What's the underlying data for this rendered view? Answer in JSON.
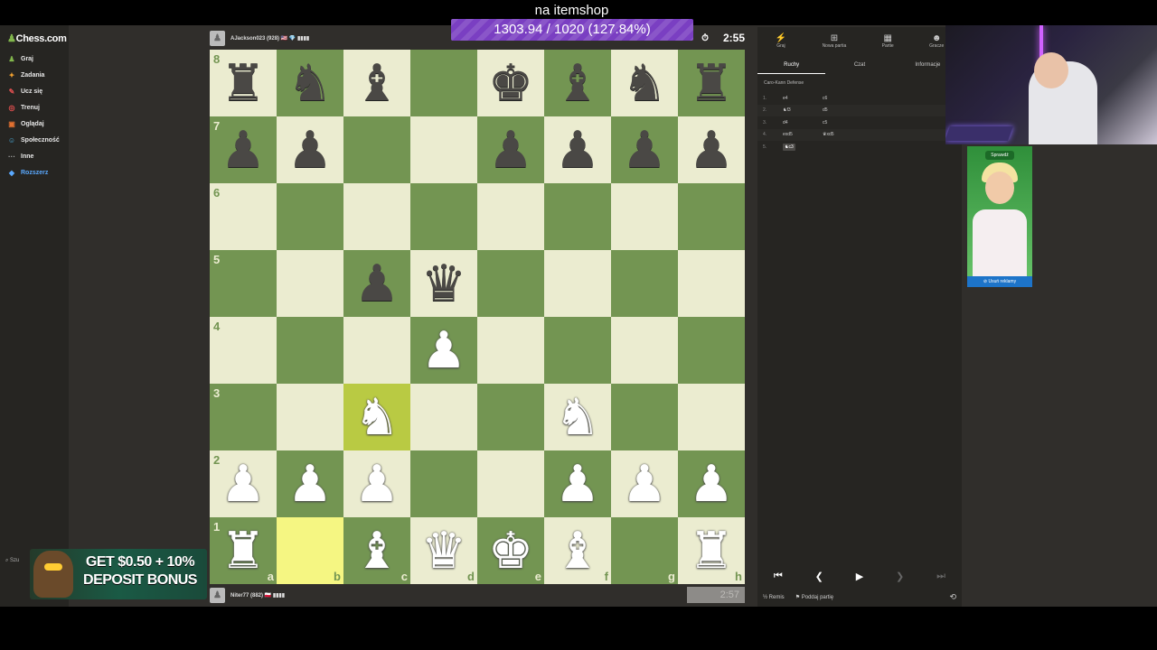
{
  "stream": {
    "title": "na itemshop",
    "counter": "1303.94 / 1020 (127.84%)"
  },
  "sidebar": {
    "logo": "Chess.com",
    "items": [
      {
        "label": "Graj",
        "icon": "play-icon",
        "glyph": "♟",
        "color": "#81b64c"
      },
      {
        "label": "Zadania",
        "icon": "puzzle-icon",
        "glyph": "✦",
        "color": "#f0a030"
      },
      {
        "label": "Ucz się",
        "icon": "learn-icon",
        "glyph": "✎",
        "color": "#e05050"
      },
      {
        "label": "Trenuj",
        "icon": "train-icon",
        "glyph": "◎",
        "color": "#e85050"
      },
      {
        "label": "Oglądaj",
        "icon": "watch-icon",
        "glyph": "▣",
        "color": "#e07030"
      },
      {
        "label": "Społeczność",
        "icon": "community-icon",
        "glyph": "☺",
        "color": "#4ab0e0"
      },
      {
        "label": "Inne",
        "icon": "more-icon",
        "glyph": "···",
        "color": "#aaa"
      },
      {
        "label": "Rozszerz",
        "icon": "diamond-icon",
        "glyph": "◆",
        "color": "#5aa9ff"
      }
    ],
    "bottom": "Szu"
  },
  "top_player": {
    "name": "AJackson023 (928) 🇺🇸 💎 ▮▮▮▮",
    "clock": "2:55",
    "clock_icon": "stopwatch-icon"
  },
  "bottom_player": {
    "name": "Niter77 (882) 🇵🇱 ▮▮▮▮",
    "clock": "2:57"
  },
  "board": {
    "ranks": [
      "8",
      "7",
      "6",
      "5",
      "4",
      "3",
      "2",
      "1"
    ],
    "files": [
      "a",
      "b",
      "c",
      "d",
      "e",
      "f",
      "g",
      "h"
    ],
    "rows": [
      [
        "r",
        "n",
        "b",
        "",
        "k",
        "b",
        "n",
        "r"
      ],
      [
        "p",
        "p",
        "",
        "",
        "p",
        "p",
        "p",
        "p"
      ],
      [
        "",
        "",
        "",
        "",
        "",
        "",
        "",
        ""
      ],
      [
        "",
        "",
        "p",
        "q",
        "",
        "",
        "",
        ""
      ],
      [
        "",
        "",
        "",
        "P",
        "",
        "",
        "",
        ""
      ],
      [
        "",
        "",
        "N",
        "",
        "",
        "N",
        "",
        ""
      ],
      [
        "P",
        "P",
        "P",
        "",
        "",
        "P",
        "P",
        "P"
      ],
      [
        "R",
        "",
        "B",
        "Q",
        "K",
        "B",
        "",
        "R"
      ]
    ],
    "highlights": [
      "b1",
      "c3"
    ]
  },
  "panel": {
    "top_tabs": [
      {
        "label": "Graj",
        "icon": "bolt-icon",
        "glyph": "⚡"
      },
      {
        "label": "Nowa partia",
        "icon": "new-game-icon",
        "glyph": "⊞"
      },
      {
        "label": "Partie",
        "icon": "games-icon",
        "glyph": "▦"
      },
      {
        "label": "Gracze",
        "icon": "players-icon",
        "glyph": "☻"
      }
    ],
    "sub_tabs": [
      "Ruchy",
      "Czat",
      "Informacje"
    ],
    "opening": "Caro-Kann Defense",
    "moves": [
      {
        "no": "1.",
        "w": "e4",
        "b": "c6"
      },
      {
        "no": "2.",
        "w": "♞f3",
        "b": "d5"
      },
      {
        "no": "3.",
        "w": "d4",
        "b": "c5"
      },
      {
        "no": "4.",
        "w": "exd5",
        "b": "♛xd5"
      },
      {
        "no": "5.",
        "w": "♞c3",
        "b": ""
      }
    ],
    "draw_label": "Remis",
    "resign_label": "Poddaj partię"
  },
  "ad": {
    "button": "Sprawdź",
    "remove": "Usuń reklamy"
  },
  "bonus": {
    "line1": "GET $0.50 + 10%",
    "line2": "DEPOSIT BONUS"
  }
}
